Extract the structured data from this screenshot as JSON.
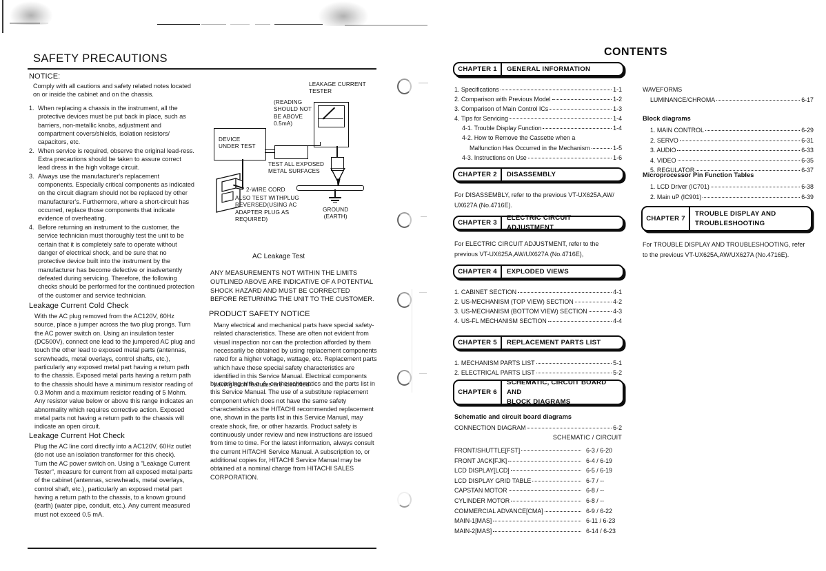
{
  "page": {
    "left_section_title": "SAFETY PRECAUTIONS",
    "contents_title": "CONTENTS"
  },
  "safety": {
    "notice_heading": "NOTICE:",
    "notice_body": "Comply with all cautions and safety related notes located on or inside the cabinet and on the chassis.",
    "numbered_items": [
      {
        "n": "1.",
        "text": "When replacing a chassis in the instrument, all the protective devices must be put back in place, such as barriers, non-metallic knobs, adjustment and compartment covers/shields, isolation resistors/ capacitors, etc."
      },
      {
        "n": "2.",
        "text": "When service is required, observe the original lead-ress.  Extra precautions should be taken to assure correct lead dress in the high voltage circuit."
      },
      {
        "n": "3.",
        "text": "Always use the manufacturer's replacement components.  Especially critical components as indicated on the circuit diagram should not be replaced by other manufacturer's.  Furthermore, where a short-circuit has occurred, replace those components that indicate evidence of overheating."
      },
      {
        "n": "4.",
        "text": "Before returning an instrument to the customer, the service technician must thoroughly test the unit to be certain that it is completely safe to operate without danger of electrical shock, and be sure that no protective device built into the instrument by the manufacturer has become defective or inadvertently defeated during servicing.  Therefore, the following checks should be performed for the continued protection of the customer and service technician."
      }
    ],
    "cold_check_heading": "Leakage Current Cold Check",
    "cold_check_body": "With the AC plug removed from the AC120V, 60Hz source, place a jumper across the two plug prongs. Turn the AC power switch on.  Using an insulation tester (DC500V), connect one lead to the jumpered AC plug and touch the other lead to exposed metal parts (antennas, screwheads, metal overlays, control shafts, etc.), particularly any exposed metal part having a return path to the chassis.  Exposed metal parts having a return path to the chassis should have a minimum resistor reading of 0.3 Mohm and a maximum resistor reading of 5 Mohm.  Any resistor value below or above this range indicates an abnormality which requires corrective action. Exposed metal parts not having a return path to the chassis will indicate an open circuit.",
    "hot_check_heading": "Leakage Current Hot Check",
    "hot_check_body": "Plug the AC line cord directly into a AC120V, 60Hz outlet (do not use an isolation transformer for this check).\nTurn the AC power switch on.  Using a \"Leakage Current Tester\", measure for current from all exposed metal parts of the cabinet (antennas, screwheads, metal overlays, control shaft, etc.), particularly an exposed metal part having a return path to the chassis, to a known ground (earth) (water pipe, conduit, etc.).  Any current measured must not exceed 0.5 mA."
  },
  "diagram": {
    "caption": "AC Leakage Test",
    "labels": {
      "tester": "LEAKAGE CURRENT\nTESTER",
      "reading": "(READING\nSHOULD NOT\nBE ABOVE\n0.5mA)",
      "device_under_test": "DEVICE\nUNDER TEST",
      "test_all_exposed": "TEST ALL EXPOSED\nMETAL SURFACES",
      "two_wire_cord": "2-WIRE CORD",
      "also_test": "ALSO TEST WITHPLUG\nREVERSED(USING AC\nADAPTER PLUG AS\nREQUIRED)",
      "ground": "GROUND\n(EARTH)"
    }
  },
  "middle": {
    "warning_block": "ANY MEASUREMENTS NOT WITHIN THE LIMITS OUTLINED ABOVE ARE INDICATIVE OF A POTENTIAL SHOCK HAZARD AND MUST BE CORRECTED BEFORE RETURNING THE UNIT TO THE CUSTOMER.",
    "product_safety_heading": "PRODUCT SAFETY NOTICE",
    "product_safety_part1": "Many electrical and mechanical parts have special safety-related characteristics.  These are often not evident from visual inspection nor can the protection afforded by them necessarily be obtained by using replacement components rated for a higher voltage, wattage, etc. Replacement parts which have these special safety characteristics are identified in this Service Manual. Electrical components having such features are identified",
    "product_safety_part2_pre": "by marking with a",
    "product_safety_part2_post": "on the schematics and the parts list in this Service Manual.  The use of a substitute replacement component which does not have the same safety characteristics as the HITACHI recommended replacement one, shown in the parts list in this Service Manual, may create shock, fire, or other hazards.  Product safety is continuously under review and new instructions are issued from time to time.  For the latest information, always consult the current HITACHI Service Manual.  A subscription to, or additional copies for, HITACHI Service Manual may be obtained at a nominal charge from HITACHI SALES CORPORATION."
  },
  "contents": {
    "chapters": [
      {
        "num": "CHAPTER  1",
        "title": [
          "GENERAL INFORMATION"
        ]
      },
      {
        "num": "CHAPTER  2",
        "title": [
          "DISASSEMBLY"
        ]
      },
      {
        "num": "CHAPTER  3",
        "title": [
          "ELECTRIC CIRCUIT ADJUSTMENT"
        ]
      },
      {
        "num": "CHAPTER  4",
        "title": [
          "EXPLODED VIEWS"
        ]
      },
      {
        "num": "CHAPTER  5",
        "title": [
          "REPLACEMENT PARTS LIST"
        ]
      },
      {
        "num": "CHAPTER  6",
        "title": [
          "SCHEMATIC, CIRCUIT BOARD AND",
          "BLOCK DIAGRAMS"
        ]
      },
      {
        "num": "CHAPTER  7",
        "title": [
          "TROUBLE DISPLAY AND",
          "TROUBLESHOOTING"
        ]
      }
    ],
    "ch1_items": [
      {
        "label": "1. Specifications",
        "page": "1-1",
        "indent": 0,
        "leader": true
      },
      {
        "label": "2. Comparison with Previous Model",
        "page": "1-2",
        "indent": 0,
        "leader": true
      },
      {
        "label": "3. Comparison of Main Control ICs",
        "page": "1-3",
        "indent": 0,
        "leader": true
      },
      {
        "label": "4. Tips for Servicing",
        "page": "1-4",
        "indent": 0,
        "leader": true
      },
      {
        "label": "4-1. Trouble Display Function",
        "page": "1-4",
        "indent": 1,
        "leader": true
      },
      {
        "label": "4-2. How to Remove the Cassette when a",
        "page": "",
        "indent": 1,
        "leader": false
      },
      {
        "label": "Malfunction Has Occurred in the Mechanism",
        "page": "1-5",
        "indent": 2,
        "leader": true
      },
      {
        "label": "4-3. Instructions on Use",
        "page": "1-6",
        "indent": 1,
        "leader": true
      }
    ],
    "ch2_note": "For DISASSEMBLY, refer to the previous VT-UX625A,AW/\nUX627A (No.4716E).",
    "ch3_note": "For ELECTRIC CIRCUIT ADJUSTMENT, refer to the\nprevious VT-UX625A,AW/UX627A (No.4716E),",
    "ch4_items": [
      {
        "label": "1. CABINET SECTION",
        "page": "4-1"
      },
      {
        "label": "2. US-MECHANISM (TOP VIEW) SECTION",
        "page": "4-2"
      },
      {
        "label": "3. US-MECHANISM (BOTTOM VIEW) SECTION",
        "page": "4-3"
      },
      {
        "label": "4. US-FL MECHANISM SECTION",
        "page": "4-4"
      }
    ],
    "ch5_items": [
      {
        "label": "1. MECHANISM PARTS LIST",
        "page": "5-1"
      },
      {
        "label": "2. ELECTRICAL PARTS LIST",
        "page": "5-2"
      }
    ],
    "ch6_sub_heading": "Schematic and circuit board diagrams",
    "ch6_connection": {
      "label": "CONNECTION DIAGRAM",
      "page": "6-2"
    },
    "ch6_col_header": "SCHEMATIC / CIRCUIT",
    "ch6_items": [
      {
        "label": "FRONT/SHUTTLE[FST]",
        "page": "6-3  / 6-20"
      },
      {
        "label": "FRONT JACK[FJK]",
        "page": "6-4  / 6-19"
      },
      {
        "label": "LCD DISPLAY[LCD]",
        "page": "6-5  / 6-19"
      },
      {
        "label": "LCD DISPLAY GRID TABLE",
        "page": "6-7  /  --"
      },
      {
        "label": "CAPSTAN MOTOR",
        "page": "6-8  /  --"
      },
      {
        "label": "CYLINDER MOTOR",
        "page": "6-8  /  --"
      },
      {
        "label": "COMMERCIAL ADVANCE[CMA]",
        "page": "6-9  / 6-22"
      },
      {
        "label": "MAIN-1[MAS]",
        "page": "6-11 / 6-23"
      },
      {
        "label": "MAIN-2[MAS]",
        "page": "6-14 / 6-23"
      }
    ],
    "waveforms_heading": "WAVEFORMS",
    "waveforms_items": [
      {
        "label": "LUMINANCE/CHROMA",
        "page": "6-17"
      }
    ],
    "block_diagrams_heading": "Block diagrams",
    "block_diagrams_items": [
      {
        "label": "1. MAIN CONTROL",
        "page": "6-29"
      },
      {
        "label": "2. SERVO",
        "page": "6-31"
      },
      {
        "label": "3. AUDIO",
        "page": "6-33"
      },
      {
        "label": "4. VIDEO",
        "page": "6-35"
      },
      {
        "label": "5. REGULATOR",
        "page": "6-37"
      }
    ],
    "micro_heading": "Microprocessor Pin Function Tables",
    "micro_items": [
      {
        "label": "1. LCD Driver (IC701)",
        "page": "6-38"
      },
      {
        "label": "2. Main uP (IC901)",
        "page": "6-39"
      }
    ],
    "ch7_note": "For TROUBLE DISPLAY AND TROUBLESHOOTING, refer\nto the previous VT-UX625A,AW/UX627A (No.4716E)."
  }
}
